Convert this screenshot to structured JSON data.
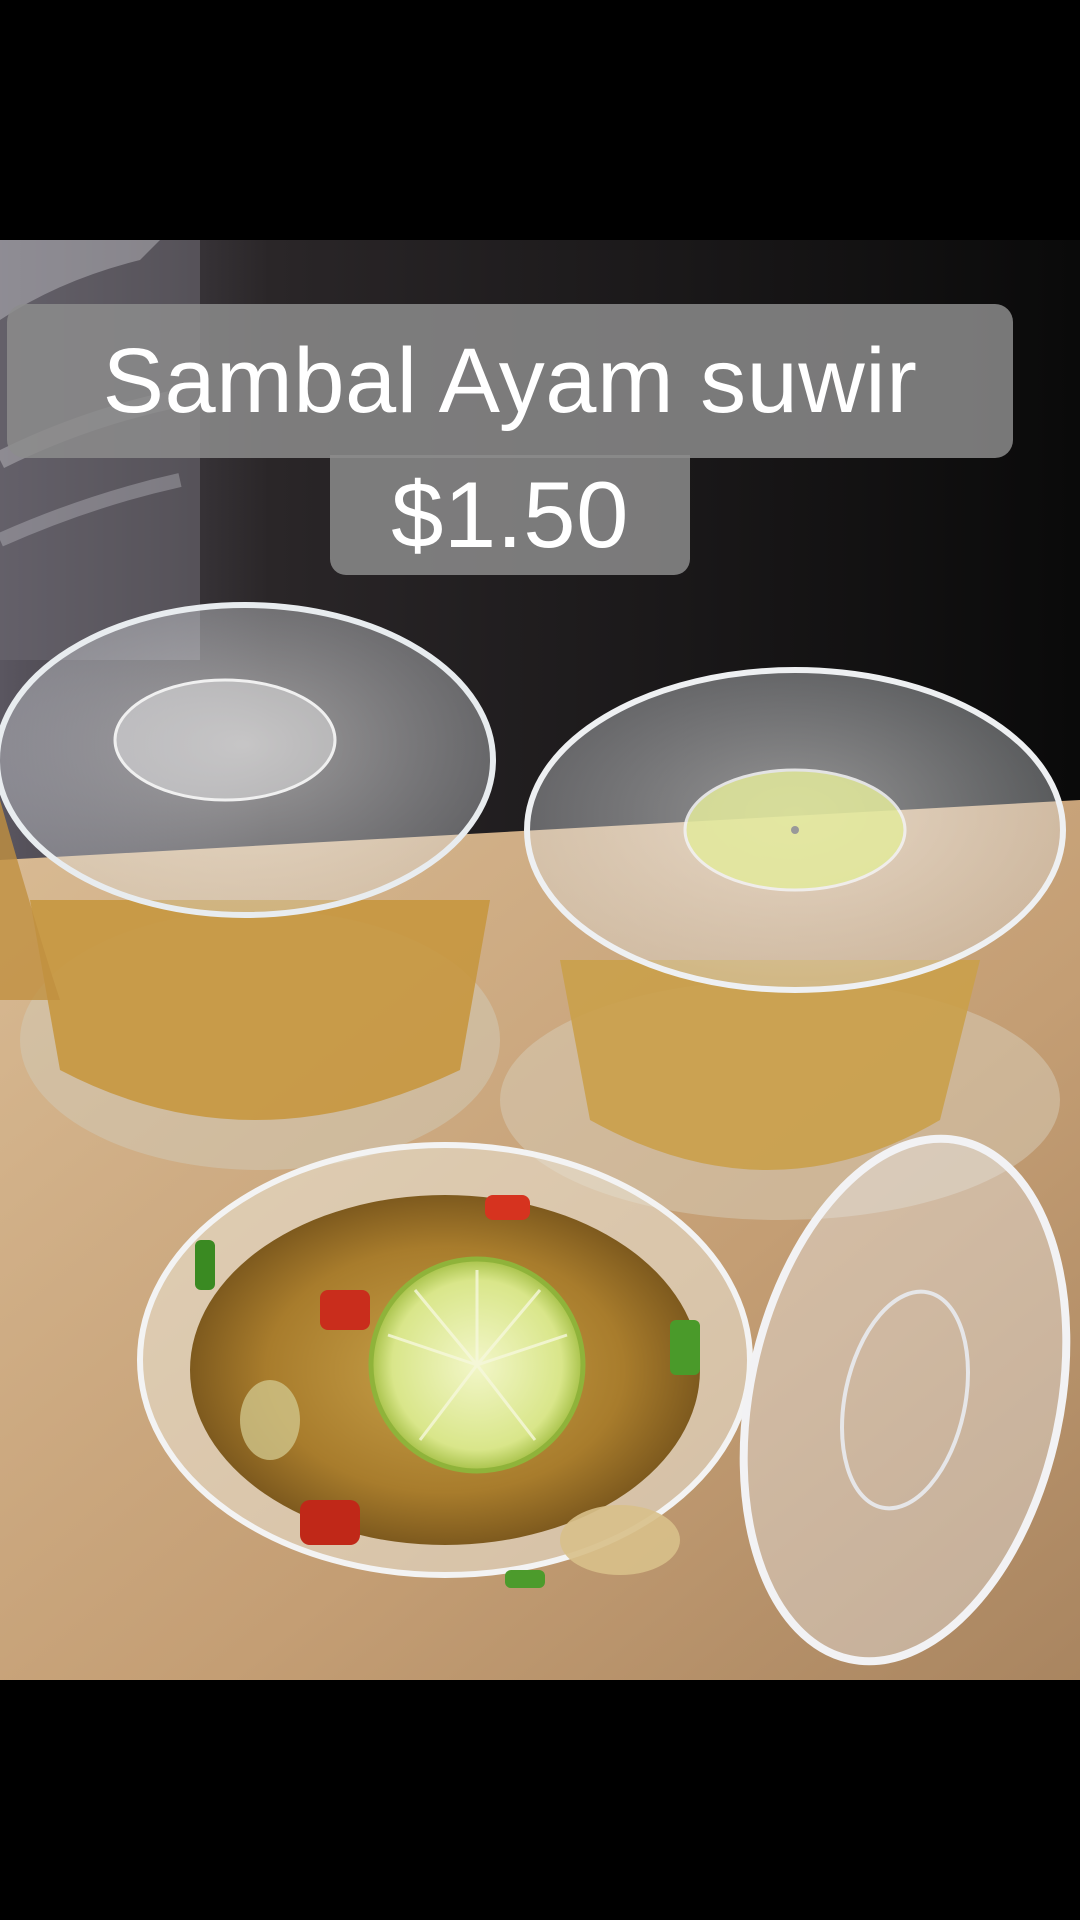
{
  "caption": {
    "title": "Sambal Ayam suwir",
    "price": "$1.50"
  },
  "colors": {
    "caption_bg": "#8c8c8c",
    "caption_text": "#ffffff",
    "backdrop": "#000000",
    "tablecloth": "#c8a882"
  }
}
